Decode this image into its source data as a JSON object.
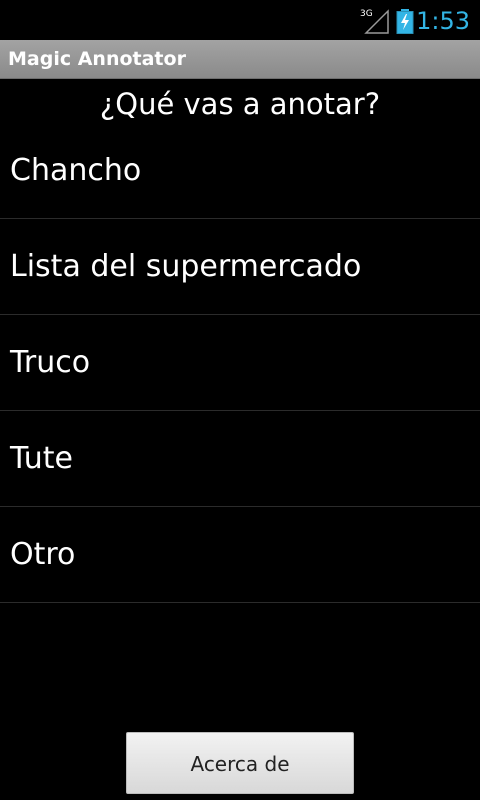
{
  "status_bar": {
    "network_type": "3G",
    "time": "1:53",
    "icons": [
      "signal-3g-icon",
      "battery-charging-icon"
    ],
    "time_color": "#33b5e5"
  },
  "app": {
    "title": "Magic Annotator"
  },
  "main": {
    "heading": "¿Qué vas a anotar?",
    "items": [
      {
        "label": "Chancho"
      },
      {
        "label": "Lista del supermercado"
      },
      {
        "label": "Truco"
      },
      {
        "label": "Tute"
      },
      {
        "label": "Otro"
      }
    ],
    "about_button": "Acerca de"
  }
}
